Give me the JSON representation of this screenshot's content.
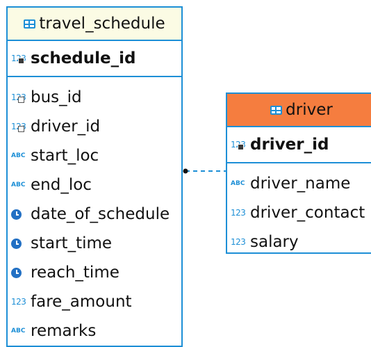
{
  "entities": {
    "travel_schedule": {
      "name": "travel_schedule",
      "primary_key": {
        "name": "schedule_id",
        "type_icon": "number-key-icon"
      },
      "attributes": [
        {
          "name": "bus_id",
          "type_icon": "number-fk-icon"
        },
        {
          "name": "driver_id",
          "type_icon": "number-fk-icon"
        },
        {
          "name": "start_loc",
          "type_icon": "text-icon"
        },
        {
          "name": "end_loc",
          "type_icon": "text-icon"
        },
        {
          "name": "date_of_schedule",
          "type_icon": "clock-icon"
        },
        {
          "name": "start_time",
          "type_icon": "clock-icon"
        },
        {
          "name": "reach_time",
          "type_icon": "clock-icon"
        },
        {
          "name": "fare_amount",
          "type_icon": "number-icon"
        },
        {
          "name": "remarks",
          "type_icon": "text-icon"
        }
      ]
    },
    "driver": {
      "name": "driver",
      "primary_key": {
        "name": "driver_id",
        "type_icon": "number-key-icon"
      },
      "attributes": [
        {
          "name": "driver_name",
          "type_icon": "text-icon"
        },
        {
          "name": "driver_contact",
          "type_icon": "number-icon"
        },
        {
          "name": "salary",
          "type_icon": "number-icon"
        }
      ]
    }
  },
  "icons": {
    "number": "123",
    "text": "ABC"
  },
  "colors": {
    "border": "#1d8fd6",
    "travel_header_bg": "#fbfbe4",
    "driver_header_bg": "#f57d3f",
    "relation_line": "#1d8fd6"
  }
}
